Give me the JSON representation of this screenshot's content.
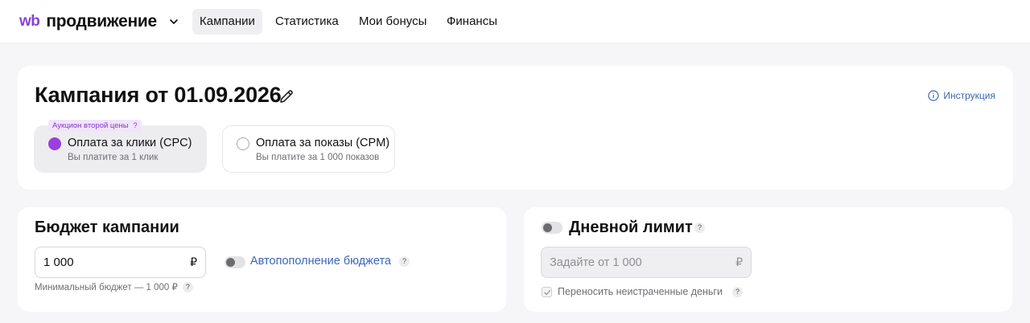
{
  "header": {
    "logo_wb": "wb",
    "logo_text": "продвижение",
    "tabs": [
      {
        "label": "Кампании",
        "active": true
      },
      {
        "label": "Статистика",
        "active": false
      },
      {
        "label": "Мои бонусы",
        "active": false
      },
      {
        "label": "Финансы",
        "active": false
      }
    ]
  },
  "campaign": {
    "title": "Кампания от 01.09.2026",
    "instruction_label": "Инструкция",
    "auction_badge": "Аукцион второй цены",
    "payment_options": [
      {
        "title": "Оплата за клики (CPC)",
        "subtitle": "Вы платите за 1 клик",
        "selected": true
      },
      {
        "title": "Оплата за показы (CPM)",
        "subtitle": "Вы платите за 1 000 показов",
        "selected": false
      }
    ]
  },
  "budget": {
    "title": "Бюджет кампании",
    "value": "1 000",
    "currency": "₽",
    "min_hint": "Минимальный бюджет — 1 000 ₽",
    "autorefill_label": "Автопополнение бюджета",
    "autorefill_enabled": false
  },
  "daily_limit": {
    "title": "Дневной лимит",
    "enabled": false,
    "placeholder": "Задайте от 1 000",
    "currency": "₽",
    "carry_over_label": "Переносить неистраченные деньги",
    "carry_over_checked": true
  },
  "help_mark": "?",
  "colors": {
    "accent": "#9a3fe0",
    "link": "#3c66b5",
    "page_bg": "#f6f6f8"
  }
}
